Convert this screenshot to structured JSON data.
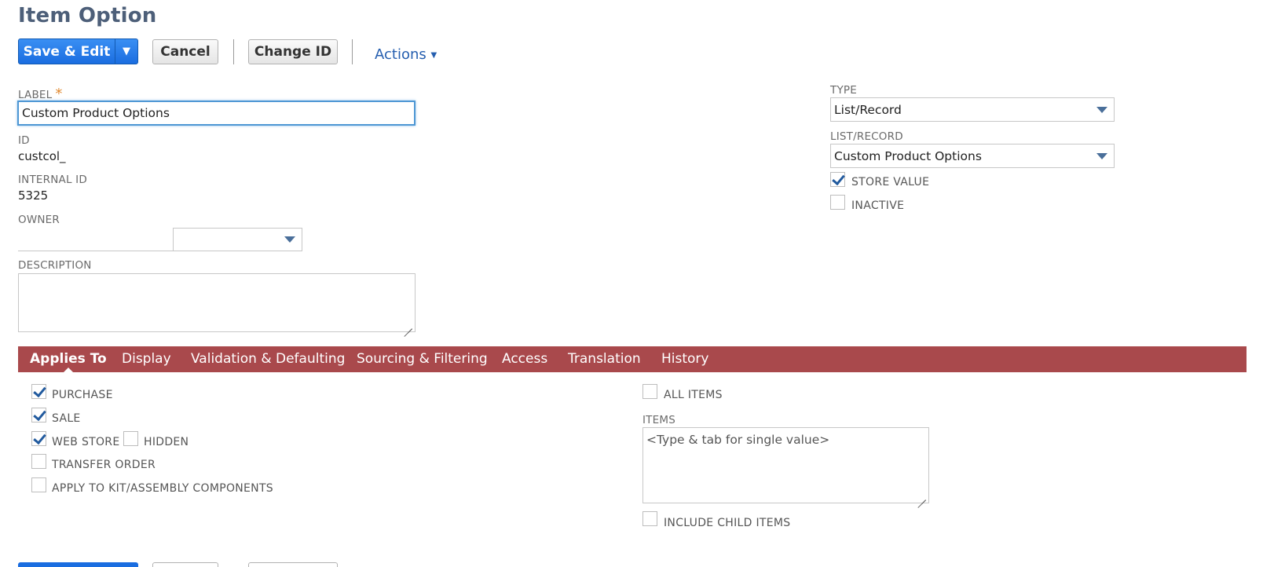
{
  "page": {
    "title": "Item Option"
  },
  "toolbar": {
    "save_edit": "Save & Edit",
    "save_drop": "▼",
    "cancel": "Cancel",
    "change_id": "Change ID",
    "actions": "Actions",
    "actions_caret": "▼"
  },
  "form": {
    "label": {
      "label": "LABEL",
      "required": "*",
      "value": "Custom Product Options"
    },
    "id": {
      "label": "ID",
      "value": "custcol_"
    },
    "internal_id": {
      "label": "INTERNAL ID",
      "value": "5325"
    },
    "owner": {
      "label": "OWNER",
      "value": ""
    },
    "description": {
      "label": "DESCRIPTION",
      "value": ""
    },
    "type": {
      "label": "TYPE",
      "value": "List/Record"
    },
    "list_record": {
      "label": "LIST/RECORD",
      "value": "Custom Product Options"
    },
    "store_value": {
      "label": "STORE VALUE",
      "checked": true
    },
    "inactive": {
      "label": "INACTIVE",
      "checked": false
    }
  },
  "tabs": [
    {
      "label": "Applies To",
      "active": true
    },
    {
      "label": "Display",
      "active": false
    },
    {
      "label": "Validation & Defaulting",
      "active": false
    },
    {
      "label": "Sourcing & Filtering",
      "active": false
    },
    {
      "label": "Access",
      "active": false
    },
    {
      "label": "Translation",
      "active": false
    },
    {
      "label": "History",
      "active": false
    }
  ],
  "applies_to": {
    "purchase": {
      "label": "PURCHASE",
      "checked": true
    },
    "sale": {
      "label": "SALE",
      "checked": true
    },
    "web_store": {
      "label": "WEB STORE",
      "checked": true
    },
    "hidden": {
      "label": "HIDDEN",
      "checked": false
    },
    "transfer_order": {
      "label": "TRANSFER ORDER",
      "checked": false
    },
    "kit_assembly": {
      "label": "APPLY TO KIT/ASSEMBLY COMPONENTS",
      "checked": false
    },
    "all_items": {
      "label": "ALL ITEMS",
      "checked": false
    },
    "items": {
      "label": "ITEMS",
      "placeholder": "<Type & tab for single value>"
    },
    "include_child": {
      "label": "INCLUDE CHILD ITEMS",
      "checked": false
    }
  },
  "colors": {
    "tab_bar": "#a9494c",
    "primary": "#1a6de0",
    "title": "#4d5f79",
    "link": "#255eaf",
    "check": "#215a9e"
  }
}
